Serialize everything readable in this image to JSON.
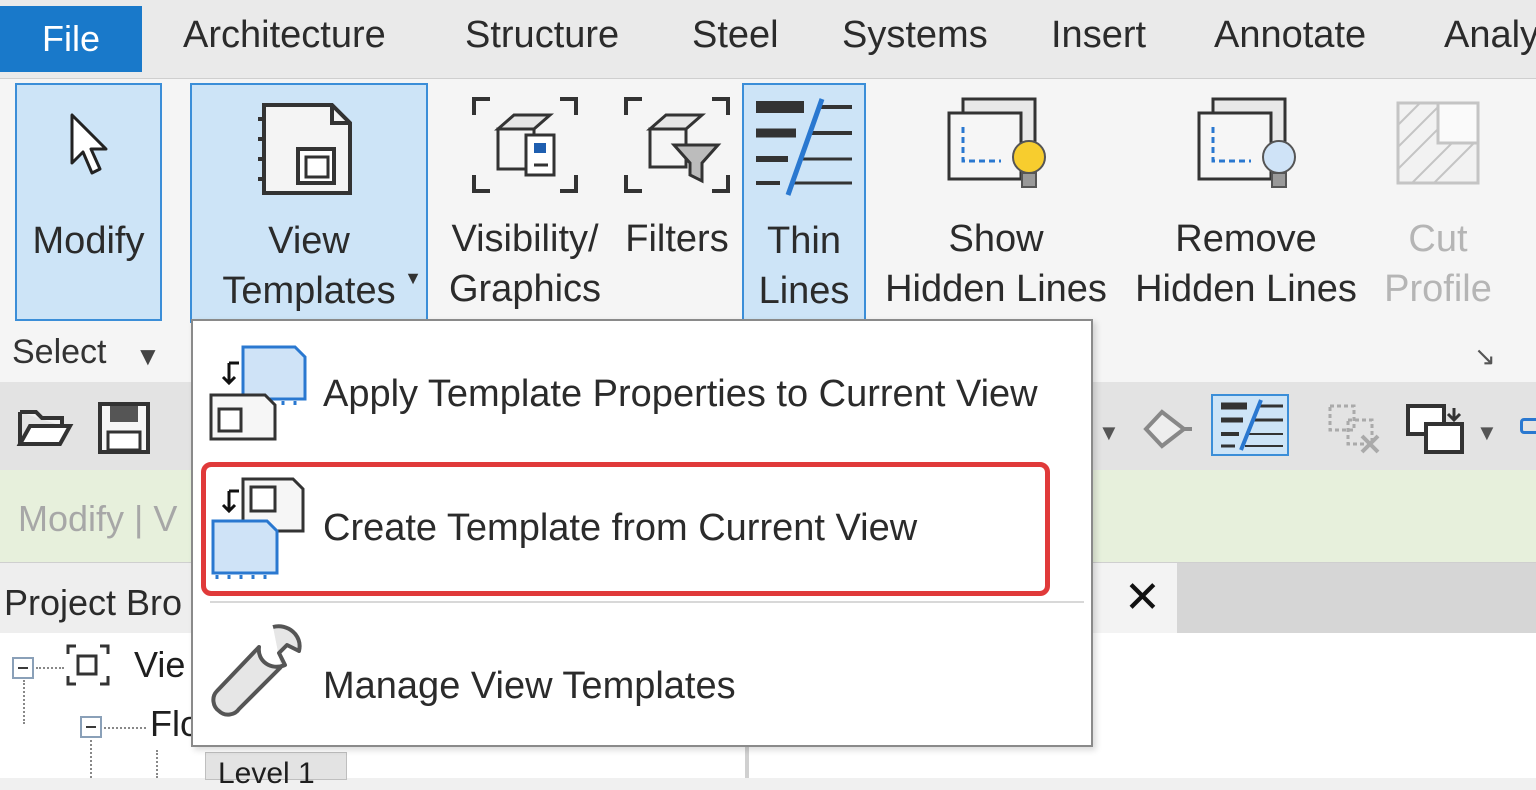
{
  "tabs": {
    "file": "File",
    "items": [
      "Architecture",
      "Structure",
      "Steel",
      "Systems",
      "Insert",
      "Annotate",
      "Analy"
    ]
  },
  "ribbon": {
    "modify": "Modify",
    "view_templates_line1": "View",
    "view_templates_line2": "Templates",
    "visibility_line1": "Visibility/",
    "visibility_line2": "Graphics",
    "filters": "Filters",
    "thin_lines_line1": "Thin",
    "thin_lines_line2": "Lines",
    "show_hidden_line1": "Show",
    "show_hidden_line2": "Hidden Lines",
    "remove_hidden_line1": "Remove",
    "remove_hidden_line2": "Hidden Lines",
    "cut_profile_line1": "Cut",
    "cut_profile_line2": "Profile",
    "panel_select": "Select"
  },
  "options_bar": {
    "text": "Modify | V"
  },
  "project_browser": {
    "title": "Project Bro",
    "views_label": "Vie",
    "floor_label": "Flo",
    "level_label": "Level 1"
  },
  "view_tab": {
    "close": "✕"
  },
  "menu": {
    "items": [
      {
        "label": "Apply Template Properties to Current View",
        "icon": "apply-template-icon"
      },
      {
        "label": "Create Template from Current View",
        "icon": "create-template-icon"
      },
      {
        "label": "Manage View Templates",
        "icon": "wrench-icon"
      }
    ]
  },
  "colors": {
    "file_tab": "#1979ca",
    "active_button": "#cde4f7",
    "highlight_box": "#e03a3a",
    "options_bar": "#e7f0dc"
  }
}
